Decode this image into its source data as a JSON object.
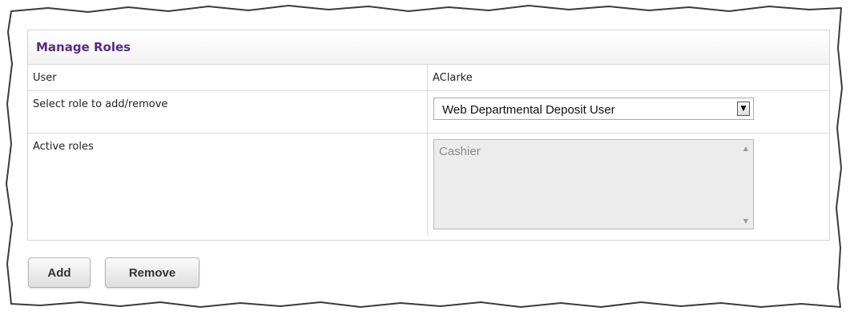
{
  "panel": {
    "title": "Manage Roles"
  },
  "form": {
    "user_label": "User",
    "user_value": "AClarke",
    "role_label": "Select role to add/remove",
    "role_selected": "Web Departmental Deposit User",
    "active_label": "Active roles",
    "active_roles": [
      "Cashier"
    ]
  },
  "buttons": {
    "add_label": "Add",
    "remove_label": "Remove"
  },
  "colors": {
    "title": "#5a2a82",
    "border": "#d9d9d9",
    "listbox_disabled": "#ececec"
  },
  "icons": {
    "dropdown": "chevron-down-icon",
    "scroll_up": "scroll-up-icon",
    "scroll_down": "scroll-down-icon"
  }
}
